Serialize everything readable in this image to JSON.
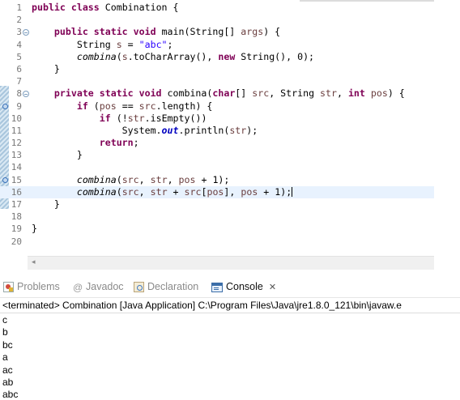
{
  "editor": {
    "lines": [
      {
        "n": "1",
        "marker": "",
        "bp": false,
        "current": false,
        "tokens": [
          [
            "kw",
            "public class "
          ],
          [
            "plain",
            "Combination {"
          ]
        ]
      },
      {
        "n": "2",
        "marker": "",
        "bp": false,
        "current": false,
        "tokens": []
      },
      {
        "n": "3",
        "marker": "fold",
        "bp": false,
        "current": false,
        "tokens": [
          [
            "plain",
            "    "
          ],
          [
            "kw",
            "public static void "
          ],
          [
            "plain",
            "main(String[] "
          ],
          [
            "param",
            "args"
          ],
          [
            "plain",
            ") {"
          ]
        ]
      },
      {
        "n": "4",
        "marker": "",
        "bp": false,
        "current": false,
        "tokens": [
          [
            "plain",
            "        String "
          ],
          [
            "param",
            "s"
          ],
          [
            "plain",
            " = "
          ],
          [
            "str",
            "\"abc\""
          ],
          [
            "plain",
            ";"
          ]
        ]
      },
      {
        "n": "5",
        "marker": "",
        "bp": false,
        "current": false,
        "tokens": [
          [
            "plain",
            "        "
          ],
          [
            "ital",
            "combina"
          ],
          [
            "plain",
            "("
          ],
          [
            "param",
            "s"
          ],
          [
            "plain",
            ".toCharArray(), "
          ],
          [
            "kw",
            "new "
          ],
          [
            "plain",
            "String(), 0);"
          ]
        ]
      },
      {
        "n": "6",
        "marker": "",
        "bp": false,
        "current": false,
        "tokens": [
          [
            "plain",
            "    }"
          ]
        ]
      },
      {
        "n": "7",
        "marker": "",
        "bp": false,
        "current": false,
        "tokens": []
      },
      {
        "n": "8",
        "marker": "fold",
        "bp": false,
        "current": false,
        "tokens": [
          [
            "plain",
            "    "
          ],
          [
            "kw",
            "private static void "
          ],
          [
            "plain",
            "combina("
          ],
          [
            "kw",
            "char"
          ],
          [
            "plain",
            "[] "
          ],
          [
            "param",
            "src"
          ],
          [
            "plain",
            ", String "
          ],
          [
            "param",
            "str"
          ],
          [
            "plain",
            ", "
          ],
          [
            "kw",
            "int "
          ],
          [
            "param",
            "pos"
          ],
          [
            "plain",
            ") {"
          ]
        ]
      },
      {
        "n": "9",
        "marker": "",
        "bp": true,
        "current": false,
        "tokens": [
          [
            "plain",
            "        "
          ],
          [
            "kw",
            "if "
          ],
          [
            "plain",
            "("
          ],
          [
            "param",
            "pos"
          ],
          [
            "plain",
            " == "
          ],
          [
            "param",
            "src"
          ],
          [
            "plain",
            ".length) {"
          ]
        ]
      },
      {
        "n": "10",
        "marker": "",
        "bp": false,
        "current": false,
        "tokens": [
          [
            "plain",
            "            "
          ],
          [
            "kw",
            "if "
          ],
          [
            "plain",
            "(!"
          ],
          [
            "param",
            "str"
          ],
          [
            "plain",
            ".isEmpty())"
          ]
        ]
      },
      {
        "n": "11",
        "marker": "",
        "bp": false,
        "current": false,
        "tokens": [
          [
            "plain",
            "                System."
          ],
          [
            "field",
            "out"
          ],
          [
            "plain",
            ".println("
          ],
          [
            "param",
            "str"
          ],
          [
            "plain",
            ");"
          ]
        ]
      },
      {
        "n": "12",
        "marker": "",
        "bp": false,
        "current": false,
        "tokens": [
          [
            "plain",
            "            "
          ],
          [
            "kw",
            "return"
          ],
          [
            "plain",
            ";"
          ]
        ]
      },
      {
        "n": "13",
        "marker": "",
        "bp": false,
        "current": false,
        "tokens": [
          [
            "plain",
            "        }"
          ]
        ]
      },
      {
        "n": "14",
        "marker": "",
        "bp": false,
        "current": false,
        "tokens": []
      },
      {
        "n": "15",
        "marker": "",
        "bp": true,
        "current": false,
        "tokens": [
          [
            "plain",
            "        "
          ],
          [
            "ital",
            "combina"
          ],
          [
            "plain",
            "("
          ],
          [
            "param",
            "src"
          ],
          [
            "plain",
            ", "
          ],
          [
            "param",
            "str"
          ],
          [
            "plain",
            ", "
          ],
          [
            "param",
            "pos"
          ],
          [
            "plain",
            " + 1);"
          ]
        ]
      },
      {
        "n": "16",
        "marker": "",
        "bp": false,
        "current": true,
        "tokens": [
          [
            "plain",
            "        "
          ],
          [
            "ital",
            "combina"
          ],
          [
            "plain",
            "("
          ],
          [
            "param",
            "src"
          ],
          [
            "plain",
            ", "
          ],
          [
            "param",
            "str"
          ],
          [
            "plain",
            " + "
          ],
          [
            "param",
            "src"
          ],
          [
            "plain",
            "["
          ],
          [
            "param",
            "pos"
          ],
          [
            "plain",
            "], "
          ],
          [
            "param",
            "pos"
          ],
          [
            "plain",
            " + 1);"
          ],
          [
            "caret",
            ""
          ]
        ]
      },
      {
        "n": "17",
        "marker": "",
        "bp": false,
        "current": false,
        "tokens": [
          [
            "plain",
            "    }"
          ]
        ]
      },
      {
        "n": "18",
        "marker": "",
        "bp": false,
        "current": false,
        "tokens": []
      },
      {
        "n": "19",
        "marker": "",
        "bp": false,
        "current": false,
        "tokens": [
          [
            "plain",
            "}"
          ]
        ]
      },
      {
        "n": "20",
        "marker": "",
        "bp": false,
        "current": false,
        "tokens": []
      }
    ]
  },
  "tabs": {
    "problems": "Problems",
    "javadoc": "Javadoc",
    "declaration": "Declaration",
    "console": "Console",
    "console_close": "✕",
    "javadoc_glyph": "@"
  },
  "console": {
    "header": "<terminated> Combination [Java Application] C:\\Program Files\\Java\\jre1.8.0_121\\bin\\javaw.e",
    "output": [
      "c",
      "b",
      "bc",
      "a",
      "ac",
      "ab",
      "abc"
    ]
  },
  "scrollbar": {
    "left_arrow": "◂"
  },
  "colors": {
    "keyword": "#7f0055",
    "string": "#2a00ff",
    "variable": "#6a3e3e",
    "field": "#0000c0",
    "current_line": "#e8f2fe"
  }
}
